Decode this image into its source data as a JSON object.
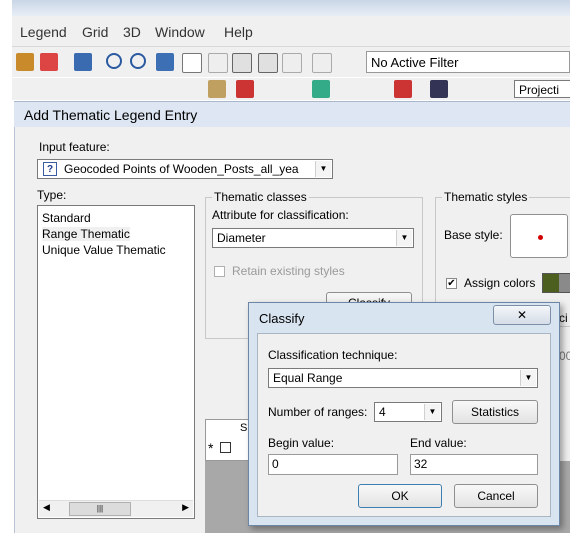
{
  "menu": [
    "Legend",
    "Grid",
    "3D",
    "Window",
    "Help"
  ],
  "filter": {
    "value": "No Active Filter"
  },
  "toolbar2_partial": "Projecti",
  "main_dialog": {
    "title": "Add Thematic Legend Entry",
    "input_feature_label": "Input feature:",
    "input_feature_value": "Geocoded Points of Wooden_Posts_all_yea",
    "type_label": "Type:",
    "types": [
      "Standard",
      "Range Thematic",
      "Unique Value Thematic"
    ],
    "selected_type": "Range Thematic",
    "thematic_classes_title": "Thematic classes",
    "attribute_label": "Attribute for classification:",
    "attribute_value": "Diameter",
    "retain_label": "Retain existing styles",
    "classify_button_partial": "Classify",
    "thematic_styles_title": "Thematic styles",
    "base_style_label": "Base style:",
    "assign_colors_label": "Assign colors",
    "partial_right_text": "ci",
    "partial_right_text2": "00",
    "grid_star": "*",
    "grid_col": "S"
  },
  "classify": {
    "title": "Classify",
    "technique_label": "Classification technique:",
    "technique_value": "Equal Range",
    "ranges_label": "Number of ranges:",
    "ranges_value": "4",
    "statistics_button": "Statistics",
    "begin_label": "Begin value:",
    "begin_value": "0",
    "end_label": "End value:",
    "end_value": "32",
    "ok_button": "OK",
    "cancel_button": "Cancel",
    "close_icon": "close-icon"
  },
  "colors": {
    "accent_red": "#d40000",
    "color_swatch": "#4d5f1e"
  }
}
